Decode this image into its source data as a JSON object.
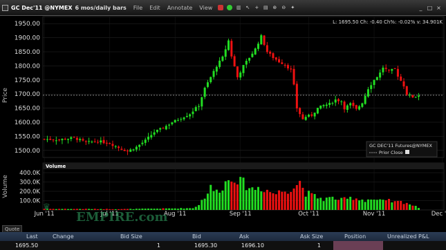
{
  "titlebar": {
    "title": "GC Dec'11 @NYMEX",
    "timeframe": "6 mos/daily bars",
    "menu": [
      "File",
      "Edit",
      "Annotate",
      "View"
    ],
    "icons": [
      "record-icon",
      "green-circle-icon",
      "bars-icon",
      "cursor-icon",
      "crosshair-icon",
      "chart-icon",
      "zoom-in-icon",
      "zoom-out-icon",
      "settings-icon"
    ]
  },
  "window_controls": [
    "_",
    "□",
    "×"
  ],
  "info_bar": "L: 1695.50  Ch: -0.40  Ch%: -0.02% v: 34.901K",
  "legend": {
    "title": "GC DEC'11 Futures@NYMEX",
    "prior_close_label": "Prior Close"
  },
  "volume_label": "Volume",
  "watermark": "EMPIRE.com",
  "quote_tab": "Quote",
  "colors": {
    "up": "#22dd22",
    "down": "#ee1111",
    "prior_close": "#888888",
    "background": "#000000",
    "grid": "#2a2a2a"
  },
  "chart_data": {
    "type": "candlestick",
    "price_axis": {
      "label": "Price",
      "ticks": [
        "1950.00",
        "1900.00",
        "1850.00",
        "1800.00",
        "1750.00",
        "1700.00",
        "1650.00",
        "1600.00",
        "1550.00",
        "1500.00"
      ],
      "values": [
        1950,
        1900,
        1850,
        1800,
        1750,
        1700,
        1650,
        1600,
        1550,
        1500
      ],
      "ylim": [
        1475,
        1975
      ]
    },
    "volume_axis": {
      "label": "Volume",
      "ticks": [
        "400.0K",
        "300.0K",
        "200.0K",
        "100.0K"
      ],
      "values": [
        400,
        300,
        200,
        100
      ],
      "ylim": [
        0,
        430
      ]
    },
    "x_axis": {
      "labels": [
        "Jun '11",
        "Jul '11",
        "Aug '11",
        "Sep '11",
        "Oct '11",
        "Nov '11",
        "Dec '11"
      ],
      "label_positions": [
        0,
        22,
        44,
        66,
        89,
        111,
        134
      ]
    },
    "prior_close": 1695.9,
    "bars_count": 127,
    "price_path": [
      [
        0,
        1540
      ],
      [
        5,
        1538
      ],
      [
        10,
        1545
      ],
      [
        14,
        1528
      ],
      [
        18,
        1533
      ],
      [
        22,
        1525
      ],
      [
        26,
        1505
      ],
      [
        28,
        1497
      ],
      [
        31,
        1512
      ],
      [
        34,
        1535
      ],
      [
        37,
        1565
      ],
      [
        40,
        1580
      ],
      [
        43,
        1600
      ],
      [
        46,
        1615
      ],
      [
        49,
        1630
      ],
      [
        52,
        1660
      ],
      [
        54,
        1720
      ],
      [
        56,
        1760
      ],
      [
        58,
        1800
      ],
      [
        60,
        1830
      ],
      [
        62,
        1890
      ],
      [
        63,
        1835
      ],
      [
        65,
        1760
      ],
      [
        67,
        1800
      ],
      [
        69,
        1830
      ],
      [
        71,
        1860
      ],
      [
        73,
        1905
      ],
      [
        75,
        1850
      ],
      [
        77,
        1830
      ],
      [
        79,
        1815
      ],
      [
        81,
        1805
      ],
      [
        83,
        1785
      ],
      [
        84,
        1730
      ],
      [
        85,
        1650
      ],
      [
        87,
        1610
      ],
      [
        88,
        1620
      ],
      [
        90,
        1625
      ],
      [
        92,
        1650
      ],
      [
        94,
        1660
      ],
      [
        96,
        1665
      ],
      [
        98,
        1680
      ],
      [
        100,
        1675
      ],
      [
        101,
        1650
      ],
      [
        103,
        1665
      ],
      [
        105,
        1645
      ],
      [
        107,
        1670
      ],
      [
        109,
        1720
      ],
      [
        111,
        1750
      ],
      [
        113,
        1775
      ],
      [
        114,
        1795
      ],
      [
        116,
        1780
      ],
      [
        118,
        1790
      ],
      [
        119,
        1765
      ],
      [
        121,
        1730
      ],
      [
        122,
        1700
      ],
      [
        124,
        1690
      ],
      [
        126,
        1695.5
      ]
    ],
    "volume_path": [
      [
        0,
        12
      ],
      [
        28,
        10
      ],
      [
        50,
        20
      ],
      [
        52,
        60
      ],
      [
        54,
        150
      ],
      [
        56,
        240
      ],
      [
        58,
        200
      ],
      [
        60,
        270
      ],
      [
        62,
        330
      ],
      [
        64,
        390
      ],
      [
        66,
        300
      ],
      [
        68,
        280
      ],
      [
        70,
        230
      ],
      [
        72,
        250
      ],
      [
        74,
        240
      ],
      [
        76,
        200
      ],
      [
        78,
        180
      ],
      [
        80,
        210
      ],
      [
        82,
        230
      ],
      [
        84,
        260
      ],
      [
        86,
        310
      ],
      [
        88,
        190
      ],
      [
        90,
        160
      ],
      [
        92,
        140
      ],
      [
        94,
        120
      ],
      [
        96,
        130
      ],
      [
        98,
        130
      ],
      [
        100,
        110
      ],
      [
        102,
        120
      ],
      [
        104,
        140
      ],
      [
        106,
        120
      ],
      [
        108,
        110
      ],
      [
        110,
        120
      ],
      [
        112,
        105
      ],
      [
        114,
        95
      ],
      [
        116,
        100
      ],
      [
        118,
        85
      ],
      [
        120,
        90
      ],
      [
        122,
        80
      ],
      [
        124,
        50
      ],
      [
        126,
        25
      ]
    ]
  },
  "quote": {
    "headers": [
      "Last",
      "Change",
      "Bid Size",
      "Bid",
      "Ask",
      "Ask Size",
      "Position",
      "Unrealized P&L"
    ],
    "values": [
      "1695.50",
      "",
      "1",
      "1695.30",
      "1696.10",
      "1",
      "",
      ""
    ]
  }
}
